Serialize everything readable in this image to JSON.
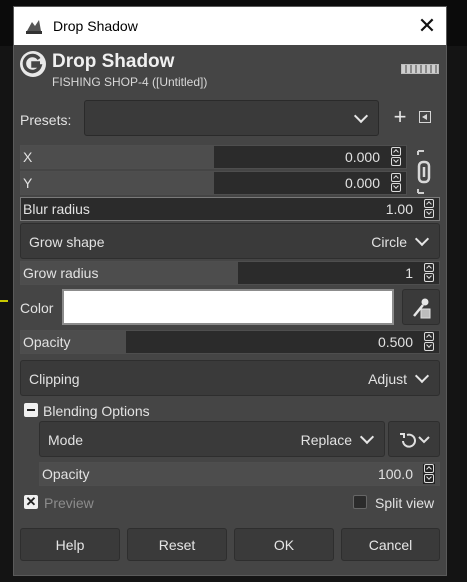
{
  "window": {
    "title": "Drop Shadow",
    "close_glyph": "✕"
  },
  "header": {
    "title": "Drop Shadow",
    "subtitle": "FISHING SHOP-4 ([Untitled])",
    "logo_icon": "gegl-logo-icon"
  },
  "presets": {
    "label": "Presets:",
    "value": "",
    "add_glyph": "+"
  },
  "offset": {
    "x": {
      "label": "X",
      "value": "0.000",
      "fill": 0.5
    },
    "y": {
      "label": "Y",
      "value": "0.000",
      "fill": 0.5
    },
    "chain_icon": "chain-link-icon"
  },
  "blur_radius": {
    "label": "Blur radius",
    "value": "1.00",
    "fill": 0.0
  },
  "grow_shape": {
    "label": "Grow shape",
    "value": "Circle"
  },
  "grow_radius": {
    "label": "Grow radius",
    "value": "1",
    "fill": 0.52
  },
  "color": {
    "label": "Color",
    "value": "#ffffff"
  },
  "opacity": {
    "label": "Opacity",
    "value": "0.500",
    "fill": 0.25
  },
  "clipping": {
    "label": "Clipping",
    "value": "Adjust"
  },
  "blending": {
    "section_label": "Blending Options",
    "mode": {
      "label": "Mode",
      "value": "Replace"
    },
    "opacity": {
      "label": "Opacity",
      "value": "100.0",
      "fill": 1.0
    }
  },
  "preview": {
    "label": "Preview",
    "checked": true,
    "check_glyph": "✕"
  },
  "split_view": {
    "label": "Split view",
    "checked": false
  },
  "buttons": {
    "help": "Help",
    "reset": "Reset",
    "ok": "OK",
    "cancel": "Cancel"
  },
  "colors": {
    "dialog_bg": "#454545",
    "field_bg": "#2b2b2b",
    "slider_fill": "#4d4d4d",
    "text": "#e2e2e2"
  }
}
